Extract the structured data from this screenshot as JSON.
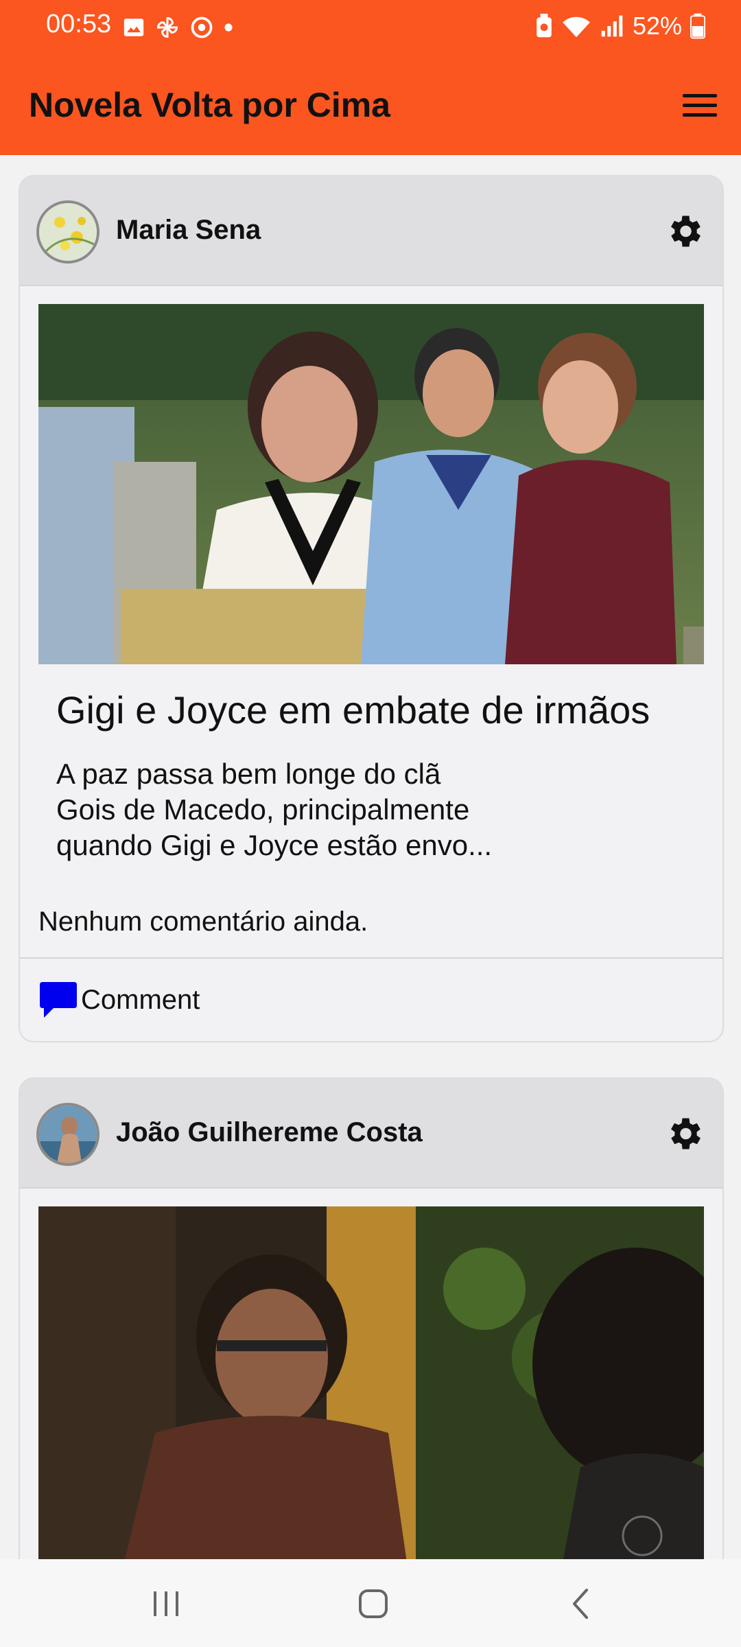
{
  "status_bar": {
    "time": "00:53",
    "battery_percent": "52%",
    "left_icons": [
      "image-icon",
      "pinwheel-icon",
      "target-icon",
      "dot-icon"
    ],
    "right_icons": [
      "battery-saver-icon",
      "wifi-icon",
      "signal-icon",
      "battery-icon"
    ]
  },
  "app_bar": {
    "title": "Novela Volta por Cima",
    "menu_icon": "hamburger-menu-icon",
    "background_color": "#fb5520"
  },
  "posts": [
    {
      "author": "Maria Sena",
      "title": "Gigi e Joyce em embate de irmãos",
      "excerpt_lines": [
        "A paz passa bem longe do clã",
        "Gois de Macedo, principalmente",
        "quando Gigi  e Joyce  estão envo..."
      ],
      "comments_text": "Nenhum comentário ainda.",
      "comment_button_label": "Comment"
    },
    {
      "author": "João Guilhereme Costa"
    }
  ],
  "colors": {
    "comment_icon": "#0000ee",
    "header_gray": "#dfdfe2"
  },
  "nav_bar": {
    "icons": [
      "recent-apps-icon",
      "home-icon",
      "back-icon"
    ]
  }
}
